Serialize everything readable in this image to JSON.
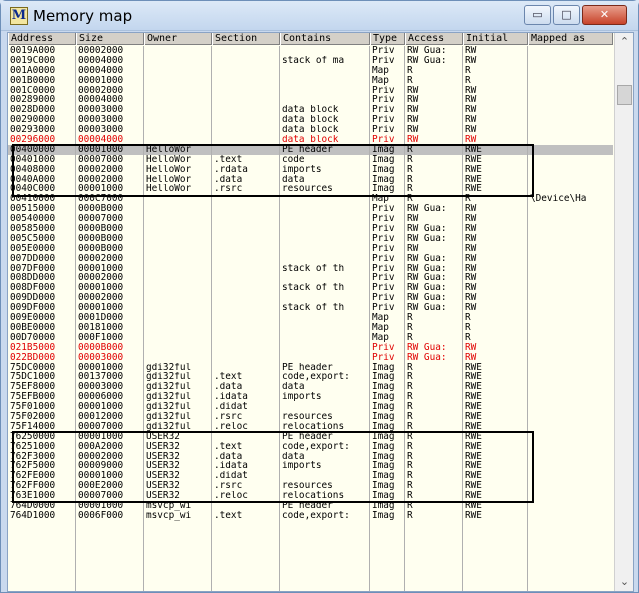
{
  "window": {
    "icon_letter": "M",
    "title": "Memory map",
    "minimize_glyph": "▭",
    "maximize_glyph": "□",
    "close_glyph": "✕"
  },
  "columns": [
    "Address",
    "Size",
    "Owner",
    "Section",
    "Contains",
    "Type",
    "Access",
    "Initial",
    "Mapped as"
  ],
  "scrollbar": {
    "up_glyph": "⌃",
    "down_glyph": "⌄"
  },
  "rows": [
    [
      "0019A000",
      "00002000",
      "",
      "",
      "",
      "Priv",
      "RW  Gua:",
      "RW",
      ""
    ],
    [
      "0019C000",
      "00004000",
      "",
      "",
      "stack of ma",
      "Priv",
      "RW  Gua:",
      "RW",
      ""
    ],
    [
      "001A0000",
      "00004000",
      "",
      "",
      "",
      "Map",
      "R",
      "R",
      ""
    ],
    [
      "001B0000",
      "00001000",
      "",
      "",
      "",
      "Map",
      "R",
      "R",
      ""
    ],
    [
      "001C0000",
      "00002000",
      "",
      "",
      "",
      "Priv",
      "RW",
      "RW",
      ""
    ],
    [
      "00289000",
      "00004000",
      "",
      "",
      "",
      "Priv",
      "RW",
      "RW",
      ""
    ],
    [
      "0028D000",
      "00003000",
      "",
      "",
      "data block",
      "Priv",
      "RW",
      "RW",
      ""
    ],
    [
      "00290000",
      "00003000",
      "",
      "",
      "data block",
      "Priv",
      "RW",
      "RW",
      ""
    ],
    [
      "00293000",
      "00003000",
      "",
      "",
      "data block",
      "Priv",
      "RW",
      "RW",
      ""
    ],
    [
      "00296000",
      "00004000",
      "",
      "",
      "data block",
      "Priv",
      "RW",
      "RW",
      ""
    ],
    [
      "00400000",
      "00001000",
      "HelloWor",
      "",
      "PE header",
      "Imag",
      "R",
      "RWE",
      ""
    ],
    [
      "00401000",
      "00007000",
      "HelloWor",
      ".text",
      "code",
      "Imag",
      "R",
      "RWE",
      ""
    ],
    [
      "00408000",
      "00002000",
      "HelloWor",
      ".rdata",
      "imports",
      "Imag",
      "R",
      "RWE",
      ""
    ],
    [
      "0040A000",
      "00002000",
      "HelloWor",
      ".data",
      "data",
      "Imag",
      "R",
      "RWE",
      ""
    ],
    [
      "0040C000",
      "00001000",
      "HelloWor",
      ".rsrc",
      "resources",
      "Imag",
      "R",
      "RWE",
      ""
    ],
    [
      "00410000",
      "000C7000",
      "",
      "",
      "",
      "Map",
      "R",
      "R",
      "\\Device\\Ha"
    ],
    [
      "00515000",
      "0000B000",
      "",
      "",
      "",
      "Priv",
      "RW  Gua:",
      "RW",
      ""
    ],
    [
      "00540000",
      "00007000",
      "",
      "",
      "",
      "Priv",
      "RW",
      "RW",
      ""
    ],
    [
      "00585000",
      "0000B000",
      "",
      "",
      "",
      "Priv",
      "RW  Gua:",
      "RW",
      ""
    ],
    [
      "005C5000",
      "0000B000",
      "",
      "",
      "",
      "Priv",
      "RW  Gua:",
      "RW",
      ""
    ],
    [
      "005E0000",
      "0000B000",
      "",
      "",
      "",
      "Priv",
      "RW",
      "RW",
      ""
    ],
    [
      "007DD000",
      "00002000",
      "",
      "",
      "",
      "Priv",
      "RW  Gua:",
      "RW",
      ""
    ],
    [
      "007DF000",
      "00001000",
      "",
      "",
      "stack of th",
      "Priv",
      "RW  Gua:",
      "RW",
      ""
    ],
    [
      "008DD000",
      "00002000",
      "",
      "",
      "",
      "Priv",
      "RW  Gua:",
      "RW",
      ""
    ],
    [
      "008DF000",
      "00001000",
      "",
      "",
      "stack of th",
      "Priv",
      "RW  Gua:",
      "RW",
      ""
    ],
    [
      "009DD000",
      "00002000",
      "",
      "",
      "",
      "Priv",
      "RW  Gua:",
      "RW",
      ""
    ],
    [
      "009DF000",
      "00001000",
      "",
      "",
      "stack of th",
      "Priv",
      "RW  Gua:",
      "RW",
      ""
    ],
    [
      "009E0000",
      "0001D000",
      "",
      "",
      "",
      "Map",
      "R",
      "R",
      ""
    ],
    [
      "00BE0000",
      "00181000",
      "",
      "",
      "",
      "Map",
      "R",
      "R",
      ""
    ],
    [
      "00D70000",
      "000F1000",
      "",
      "",
      "",
      "Map",
      "R",
      "R",
      ""
    ],
    [
      "021B5000",
      "0000B000",
      "",
      "",
      "",
      "Priv",
      "RW  Gua:",
      "RW",
      ""
    ],
    [
      "022BD000",
      "00003000",
      "",
      "",
      "",
      "Priv",
      "RW  Gua:",
      "RW",
      ""
    ],
    [
      "75DC0000",
      "00001000",
      "gdi32ful",
      "",
      "PE header",
      "Imag",
      "R",
      "RWE",
      ""
    ],
    [
      "75DC1000",
      "00137000",
      "gdi32ful",
      ".text",
      "code,export:",
      "Imag",
      "R",
      "RWE",
      ""
    ],
    [
      "75EF8000",
      "00003000",
      "gdi32ful",
      ".data",
      "data",
      "Imag",
      "R",
      "RWE",
      ""
    ],
    [
      "75EFB000",
      "00006000",
      "gdi32ful",
      ".idata",
      "imports",
      "Imag",
      "R",
      "RWE",
      ""
    ],
    [
      "75F01000",
      "00001000",
      "gdi32ful",
      ".didat",
      "",
      "Imag",
      "R",
      "RWE",
      ""
    ],
    [
      "75F02000",
      "00012000",
      "gdi32ful",
      ".rsrc",
      "resources",
      "Imag",
      "R",
      "RWE",
      ""
    ],
    [
      "75F14000",
      "00007000",
      "gdi32ful",
      ".reloc",
      "relocations",
      "Imag",
      "R",
      "RWE",
      ""
    ],
    [
      "76250000",
      "00001000",
      "USER32",
      "",
      "PE header",
      "Imag",
      "R",
      "RWE",
      ""
    ],
    [
      "76251000",
      "000A2000",
      "USER32",
      ".text",
      "code,export:",
      "Imag",
      "R",
      "RWE",
      ""
    ],
    [
      "762F3000",
      "00002000",
      "USER32",
      ".data",
      "data",
      "Imag",
      "R",
      "RWE",
      ""
    ],
    [
      "762F5000",
      "00009000",
      "USER32",
      ".idata",
      "imports",
      "Imag",
      "R",
      "RWE",
      ""
    ],
    [
      "762FE000",
      "00001000",
      "USER32",
      ".didat",
      "",
      "Imag",
      "R",
      "RWE",
      ""
    ],
    [
      "762FF000",
      "000E2000",
      "USER32",
      ".rsrc",
      "resources",
      "Imag",
      "R",
      "RWE",
      ""
    ],
    [
      "763E1000",
      "00007000",
      "USER32",
      ".reloc",
      "relocations",
      "Imag",
      "R",
      "RWE",
      ""
    ],
    [
      "764D0000",
      "00001000",
      "msvcp_wi",
      "",
      "PE header",
      "Imag",
      "R",
      "RWE",
      ""
    ],
    [
      "764D1000",
      "0006F000",
      "msvcp_wi",
      ".text",
      "code,export:",
      "Imag",
      "R",
      "RWE",
      ""
    ]
  ],
  "red_rows": [
    9,
    30,
    31
  ],
  "selected_rows": [
    10
  ],
  "highlight_groups": [
    {
      "label": "HelloWor module",
      "first_row": 10,
      "last_row": 14
    },
    {
      "label": "USER32 module",
      "first_row": 39,
      "last_row": 45
    }
  ]
}
